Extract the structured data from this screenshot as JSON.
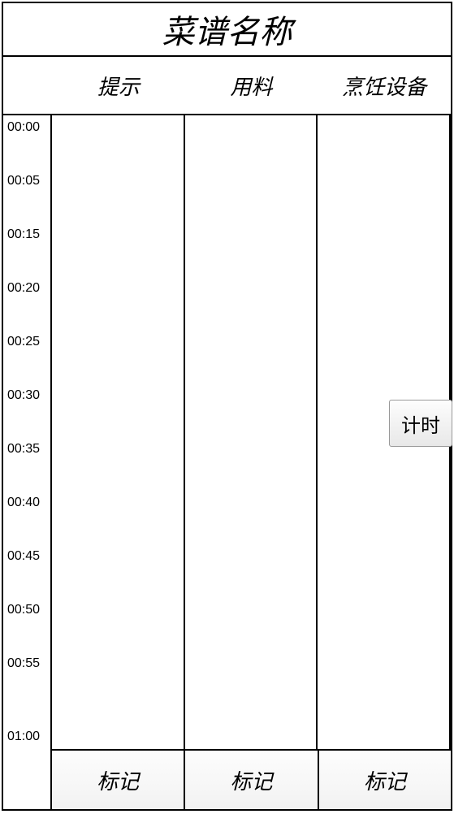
{
  "title": "菜谱名称",
  "columns": {
    "hint": "提示",
    "ingredients": "用料",
    "equipment": "烹饪设备"
  },
  "timeLabels": [
    "00:00",
    "00:05",
    "00:15",
    "00:20",
    "00:25",
    "00:30",
    "00:35",
    "00:40",
    "00:45",
    "00:50",
    "00:55",
    "01:00"
  ],
  "timerButton": "计时",
  "footerButtons": [
    "标记",
    "标记",
    "标记"
  ]
}
